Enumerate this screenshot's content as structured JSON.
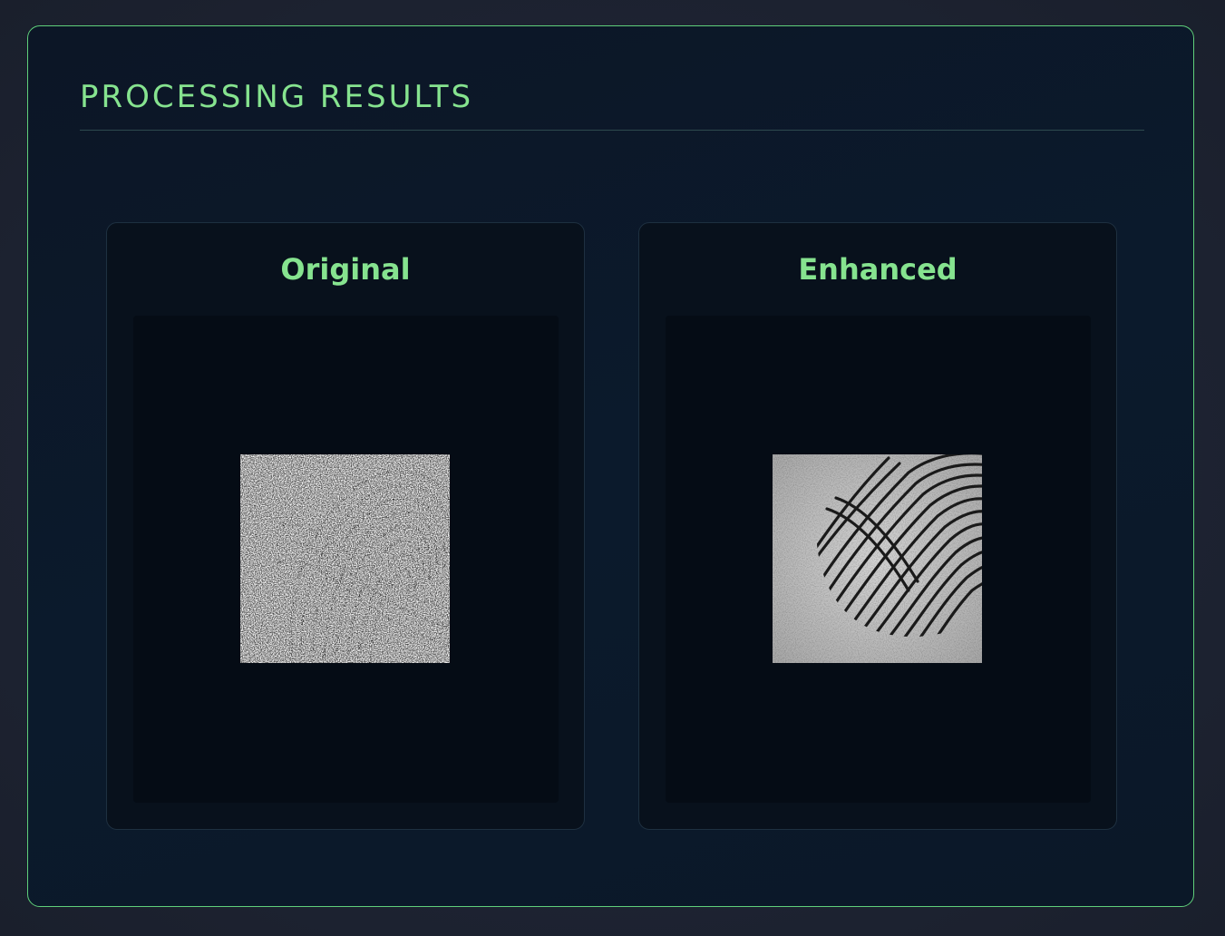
{
  "page": {
    "title": "PROCESSING RESULTS"
  },
  "results": [
    {
      "label": "Original",
      "image_icon": "fingerprint-original-image"
    },
    {
      "label": "Enhanced",
      "image_icon": "fingerprint-enhanced-image"
    }
  ],
  "colors": {
    "accent": "#86e38f",
    "panel_border": "#5fcf7a",
    "panel_bg": "#0b1a2c",
    "card_bg": "#08111c",
    "well_bg": "#050c15"
  }
}
